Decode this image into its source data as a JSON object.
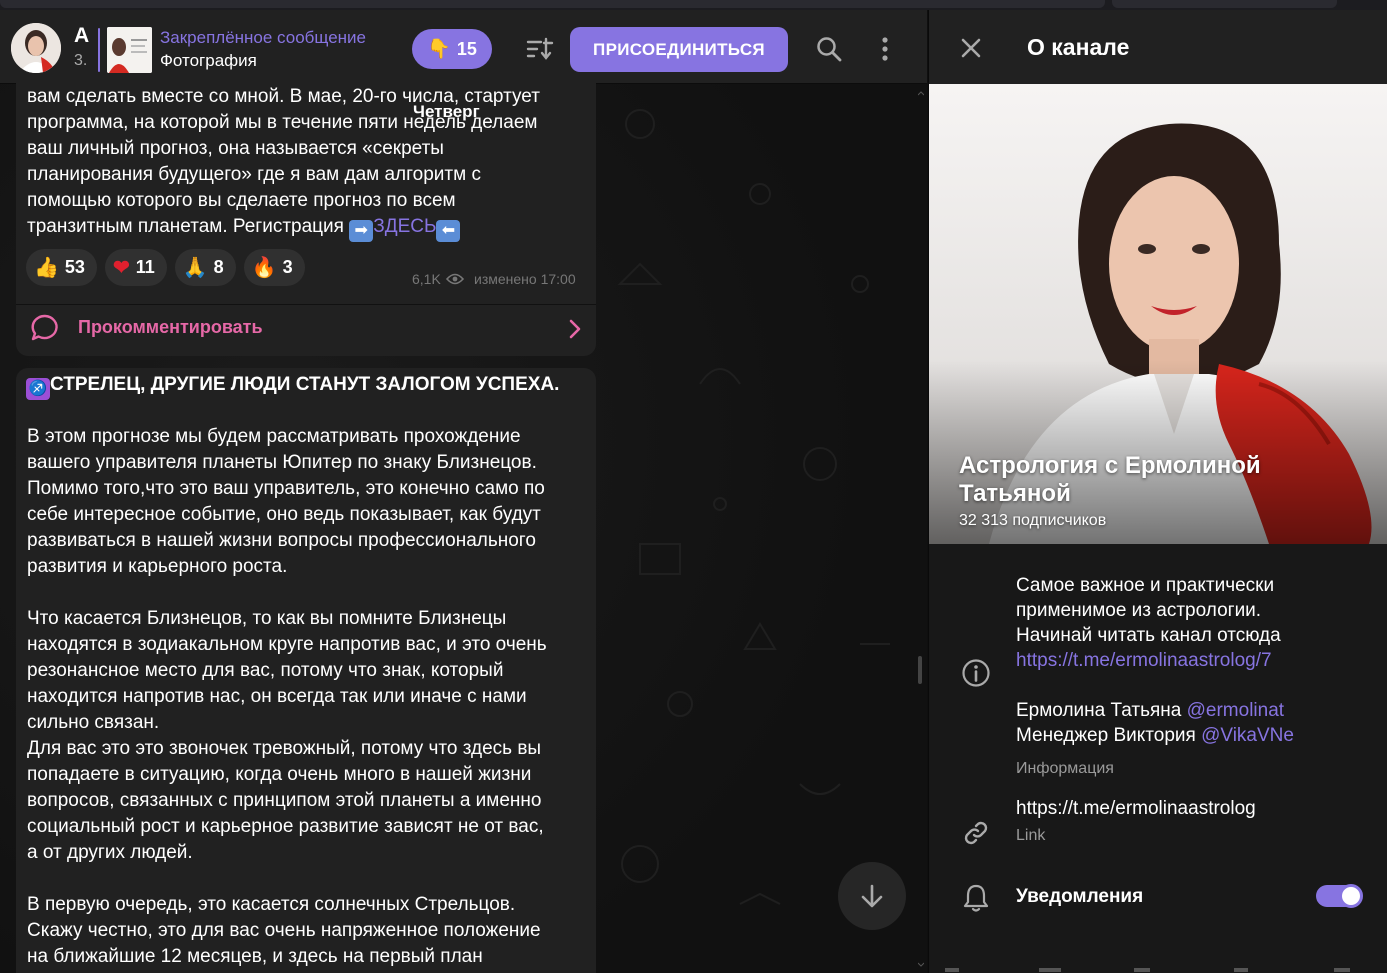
{
  "chat": {
    "header": {
      "title_letter": "А",
      "subtitle": "3.",
      "pinned_title": "Закреплённое сообщение",
      "pinned_text": "Фотография",
      "reaction_count": "15",
      "join_label": "ПРИСОЕДИНИТЬСЯ"
    },
    "date_label": "Четверг",
    "message1": {
      "lines": "вам сделать вместе со мной. В мае, 20-го числа, стартует\nпрограмма, на которой мы в течение пяти недель делаем\nваш личный прогноз, она называется «секреты\nпланирования будущего» где я вам дам алгоритм с\nпомощью которого вы сделаете прогноз по всем\nтранзитным планетам. Регистрация ",
      "link_text": "ЗДЕСЬ",
      "reactions": [
        {
          "emoji": "👍",
          "count": "53"
        },
        {
          "emoji": "❤",
          "count": "11"
        },
        {
          "emoji": "🙏",
          "count": "8"
        },
        {
          "emoji": "🔥",
          "count": "3"
        }
      ],
      "views": "6,1K",
      "edited": "изменено 17:00",
      "comment_label": "Прокомментировать"
    },
    "message2": {
      "title": "СТРЕЛЕЦ, ДРУГИЕ ЛЮДИ СТАНУТ ЗАЛОГОМ УСПЕХА.",
      "body": "В этом прогнозе мы будем рассматривать прохождение\nвашего управителя планеты Юпитер по знаку Близнецов.\nПомимо того,что это ваш управитель, это конечно само по\nсебе интересное событие, оно ведь показывает, как будут\nразвиваться в нашей жизни вопросы профессионального\nразвития и карьерного роста.\n\nЧто касается Близнецов, то как вы помните Близнецы\nнаходятся в зодиакальном круге напротив вас, и это очень\nрезонансное место для вас, потому что знак, который\nнаходится напротив нас, он всегда так или иначе с нами\nсильно связан.\nДля вас это это звоночек тревожный, потому что здесь вы\nпопадаете в ситуацию, когда очень много в нашей жизни\nвопросов, связанных с принципом этой планеты а именно\nсоциальный рост и карьерное развитие зависят не от вас,\nа от других людей.\n\nВ первую очередь, это касается солнечных Стрельцов.\nСкажу честно, это для вас очень напряженное положение\nна ближайшие 12 месяцев, и здесь на первый план"
    }
  },
  "panel": {
    "title": "О канале",
    "channel_name": "Астрология с Ермолиной Татьяной",
    "subscribers": "32 313 подписчиков",
    "description_line1": "Самое важное и практически",
    "description_line2": "применимое из астрологии.",
    "description_line3": "Начинай читать канал отсюда",
    "description_link": "https://t.me/ermolinaastrolog/7",
    "contact1_name": "Ермолина Татьяна ",
    "contact1_handle": "@ermolinat",
    "contact2_name": "Менеджер Виктория ",
    "contact2_handle": "@VikaVNe",
    "info_label": "Информация",
    "link_url": "https://t.me/ermolinaastrolog",
    "link_label": "Link",
    "notifications_label": "Уведомления",
    "notifications_on": true
  },
  "colors": {
    "accent": "#8774e1",
    "comment": "#e668a7",
    "bubble": "#212121",
    "panel": "#181818"
  }
}
